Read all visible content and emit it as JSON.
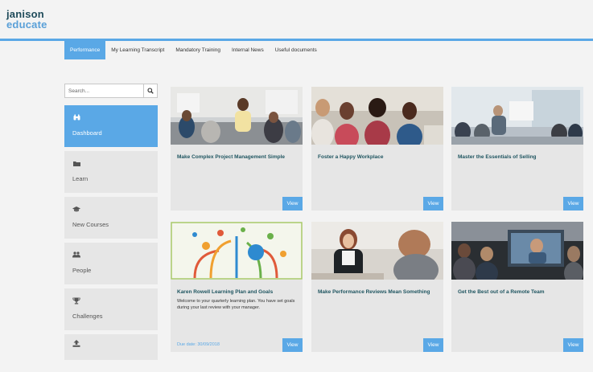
{
  "header": {
    "logo_line1": "janison",
    "logo_line2": "educate"
  },
  "nav": {
    "tabs": [
      {
        "label": "Performance",
        "active": true
      },
      {
        "label": "My Learning Transcript"
      },
      {
        "label": "Mandatory Training"
      },
      {
        "label": "Internal News"
      },
      {
        "label": "Useful documents"
      }
    ]
  },
  "search": {
    "placeholder": "Search..."
  },
  "sidebar": {
    "items": [
      {
        "label": "Dashboard",
        "icon": "binoculars-icon",
        "active": true
      },
      {
        "label": "Learn",
        "icon": "folder-icon"
      },
      {
        "label": "New Courses",
        "icon": "graduation-cap-icon"
      },
      {
        "label": "People",
        "icon": "people-icon"
      },
      {
        "label": "Challenges",
        "icon": "trophy-icon"
      },
      {
        "label": "",
        "icon": "upload-icon"
      }
    ]
  },
  "cards": [
    {
      "title": "Make Complex Project Management Simple",
      "view": "View"
    },
    {
      "title": "Foster a Happy Workplace",
      "view": "View"
    },
    {
      "title": "Master the Essentials of Selling",
      "view": "View"
    },
    {
      "title": "Karen Rowell Learning Plan and Goals",
      "desc": "Welcome to your quarterly learning plan. You have set goals during your last review with your manager.",
      "due": "Due date: 30/09/2018",
      "view": "View"
    },
    {
      "title": "Make Performance Reviews Mean Something",
      "view": "View"
    },
    {
      "title": "Get the Best out of a Remote Team",
      "view": "View"
    }
  ],
  "colors": {
    "accent": "#5aa8e6",
    "title_text": "#1f5560",
    "logo_dark": "#1f4b5a"
  }
}
